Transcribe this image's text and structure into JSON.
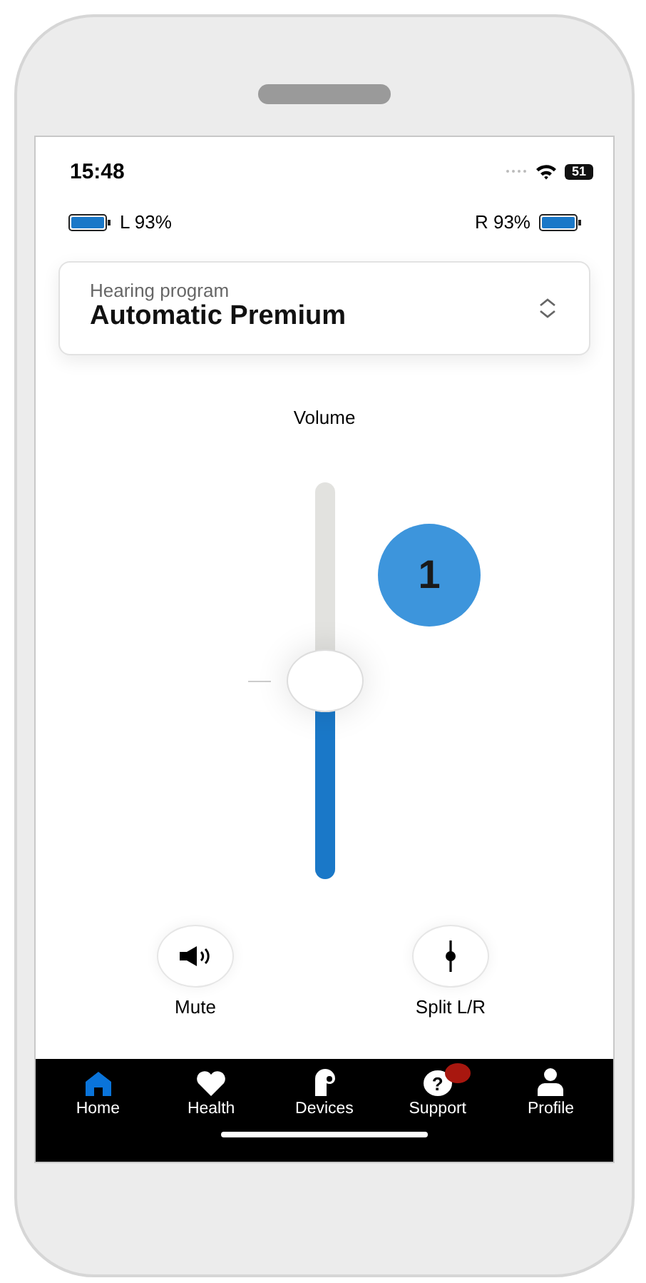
{
  "status_bar": {
    "time": "15:48",
    "battery": "51"
  },
  "hearing_aids": [
    {
      "label": "L 93%",
      "kind": "left"
    },
    {
      "label": "R 93%",
      "kind": "right"
    }
  ],
  "program": {
    "caption": "Hearing program",
    "value": "Automatic Premium"
  },
  "volume": {
    "label": "Volume",
    "level": 0.5,
    "badge": "1"
  },
  "actions": [
    {
      "kind": "mute",
      "label": "Mute"
    },
    {
      "kind": "split",
      "label": "Split L/R"
    }
  ],
  "tabs": [
    {
      "kind": "home",
      "label": "Home",
      "selected": true,
      "badge": false
    },
    {
      "kind": "health",
      "label": "Health",
      "selected": false,
      "badge": false
    },
    {
      "kind": "devices",
      "label": "Devices",
      "selected": false,
      "badge": false
    },
    {
      "kind": "support",
      "label": "Support",
      "selected": false,
      "badge": true,
      "glyph": "?"
    },
    {
      "kind": "profile",
      "label": "Profile",
      "selected": false,
      "badge": false
    }
  ]
}
